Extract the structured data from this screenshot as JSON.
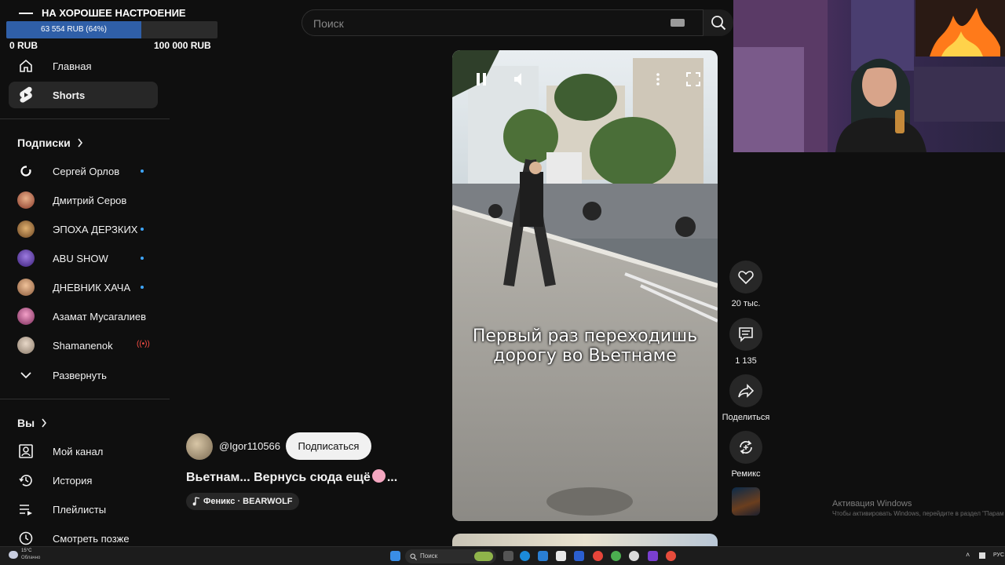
{
  "donation": {
    "title": "НА ХОРОШЕЕ НАСТРОЕНИЕ",
    "progress_text": "63 554 RUB (64%)",
    "progress_fraction": 0.64,
    "min_label": "0 RUB",
    "max_label": "100 000 RUB"
  },
  "sidebar": {
    "nav": [
      {
        "label": "Главная",
        "icon": "home-icon"
      },
      {
        "label": "Shorts",
        "icon": "shorts-icon",
        "active": true
      }
    ],
    "subscriptions_title": "Подписки",
    "subscriptions": [
      {
        "name": "Сергей Орлов",
        "status": "new"
      },
      {
        "name": "Дмитрий Серов",
        "status": "none"
      },
      {
        "name": "ЭПОХА ДЕРЗКИХ",
        "status": "new"
      },
      {
        "name": "ABU SHOW",
        "status": "new"
      },
      {
        "name": "ДНЕВНИК ХАЧА",
        "status": "new"
      },
      {
        "name": "Азамат Мусагалиев",
        "status": "none"
      },
      {
        "name": "Shamanenok",
        "status": "live"
      }
    ],
    "expand_label": "Развернуть",
    "you_title": "Вы",
    "you_items": [
      {
        "label": "Мой канал",
        "icon": "channel-icon"
      },
      {
        "label": "История",
        "icon": "history-icon"
      },
      {
        "label": "Плейлисты",
        "icon": "playlists-icon"
      },
      {
        "label": "Смотреть позже",
        "icon": "watch-later-icon"
      }
    ]
  },
  "search": {
    "placeholder": "Поиск"
  },
  "video": {
    "caption": "Первый раз переходишь\nдорогу во Вьетнаме",
    "channel_handle": "@Igor110566",
    "subscribe_label": "Подписаться",
    "title": "Вьетнам... Вернусь сюда ещё",
    "title_suffix": "...",
    "music": "Феникс · BEARWOLF"
  },
  "actions": {
    "like_count": "20 тыс.",
    "comments_count": "1 135",
    "share_label": "Поделиться",
    "remix_label": "Ремикс"
  },
  "watermark": {
    "title": "Активация Windows",
    "subtitle": "Чтобы активировать Windows, перейдите в раздел \"Парам"
  },
  "taskbar": {
    "weather_temp": "15°C",
    "weather_desc": "Облачно",
    "search_label": "Поиск",
    "language": "РУС"
  },
  "colors": {
    "background": "#0f0f0f",
    "accent_blue": "#3ea6ff",
    "live_red": "#ff4e45",
    "progress_fill": "#2f5fa8"
  }
}
